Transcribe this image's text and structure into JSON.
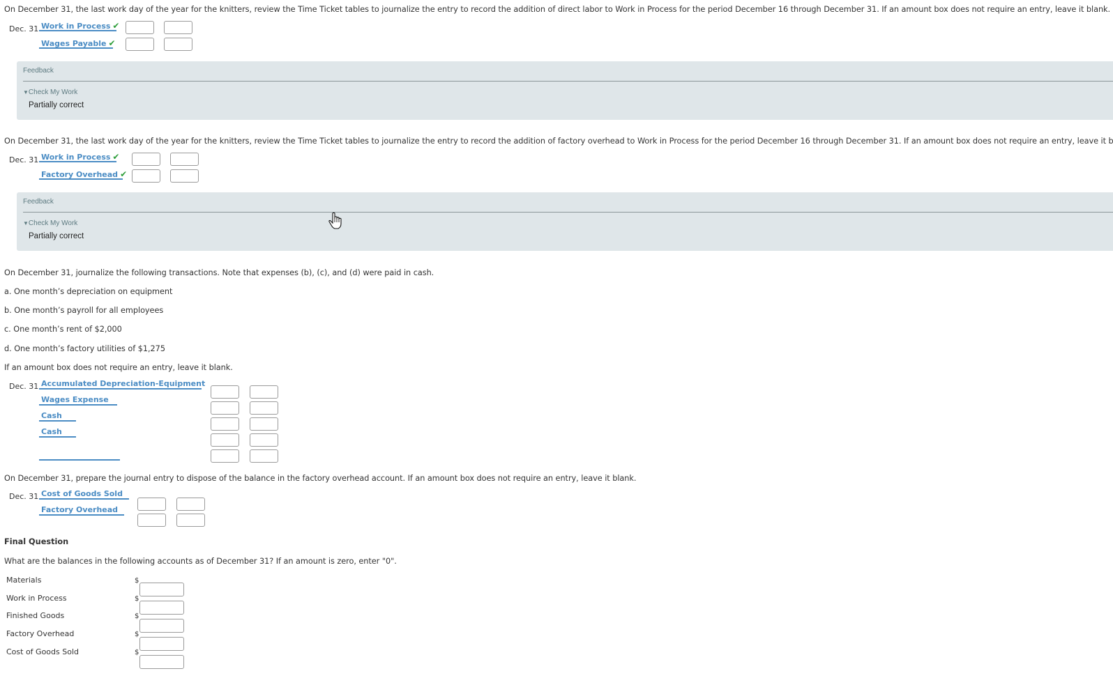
{
  "sections": {
    "direct_labor": {
      "prompt": "On December 31, the last work day of the year for the knitters, review the Time Ticket tables to journalize the entry to record the addition of direct labor to Work in Process for the period December 16 through December 31. If an amount box does not require an entry, leave it blank.",
      "date": "Dec. 31",
      "rows": [
        {
          "account": "Work in Process",
          "status": "correct",
          "debit": "",
          "credit": ""
        },
        {
          "account": "Wages Payable",
          "status": "correct",
          "debit": "",
          "credit": ""
        }
      ],
      "feedback": {
        "title": "Feedback",
        "toggle": "Check My Work",
        "result": "Partially correct"
      }
    },
    "factory_overhead": {
      "prompt": "On December 31, the last work day of the year for the knitters, review the Time Ticket tables to journalize the entry to record the addition of factory overhead to Work in Process for the period December 16 through December 31. If an amount box does not require an entry, leave it blank.",
      "date": "Dec. 31",
      "rows": [
        {
          "account": "Work in Process",
          "status": "correct",
          "debit": "",
          "credit": ""
        },
        {
          "account": "Factory Overhead",
          "status": "correct",
          "debit": "",
          "credit": ""
        }
      ],
      "feedback": {
        "title": "Feedback",
        "toggle": "Check My Work",
        "result": "Partially correct"
      }
    },
    "transactions": {
      "prompt": "On December 31, journalize the following transactions. Note that expenses (b), (c), and (d) were paid in cash.",
      "items": [
        "a. One month’s depreciation on equipment",
        "b. One month’s payroll for all employees",
        "c. One month’s rent of $2,000",
        "d. One month’s factory utilities of $1,275"
      ],
      "instruction": "If an amount box does not require an entry, leave it blank.",
      "date": "Dec. 31",
      "rows": [
        {
          "account": "Accumulated Depreciation-Equipment",
          "debit": "",
          "credit": ""
        },
        {
          "account": "Wages Expense",
          "debit": "",
          "credit": ""
        },
        {
          "account": "Cash",
          "debit": "",
          "credit": ""
        },
        {
          "account": "Cash",
          "debit": "",
          "credit": ""
        },
        {
          "account": "",
          "debit": "",
          "credit": ""
        }
      ]
    },
    "dispose_overhead": {
      "prompt": "On December 31, prepare the journal entry to dispose of the balance in the factory overhead account. If an amount box does not require an entry, leave it blank.",
      "date": "Dec. 31",
      "rows": [
        {
          "account": "Cost of Goods Sold",
          "debit": "",
          "credit": ""
        },
        {
          "account": "Factory Overhead",
          "debit": "",
          "credit": ""
        }
      ]
    },
    "final_question": {
      "heading": "Final Question",
      "prompt": "What are the balances in the following accounts as of December 31? If an amount is zero, enter \"0\".",
      "currency": "$",
      "accounts": [
        {
          "label": "Materials",
          "value": ""
        },
        {
          "label": "Work in Process",
          "value": ""
        },
        {
          "label": "Finished Goods",
          "value": ""
        },
        {
          "label": "Factory Overhead",
          "value": ""
        },
        {
          "label": "Cost of Goods Sold",
          "value": ""
        }
      ]
    }
  },
  "icons": {
    "check": "✔",
    "triangle_down": "▼"
  },
  "colors": {
    "link": "#4a8cc4",
    "check": "#2e9e3a",
    "feedback_bg": "#dfe6e9"
  }
}
